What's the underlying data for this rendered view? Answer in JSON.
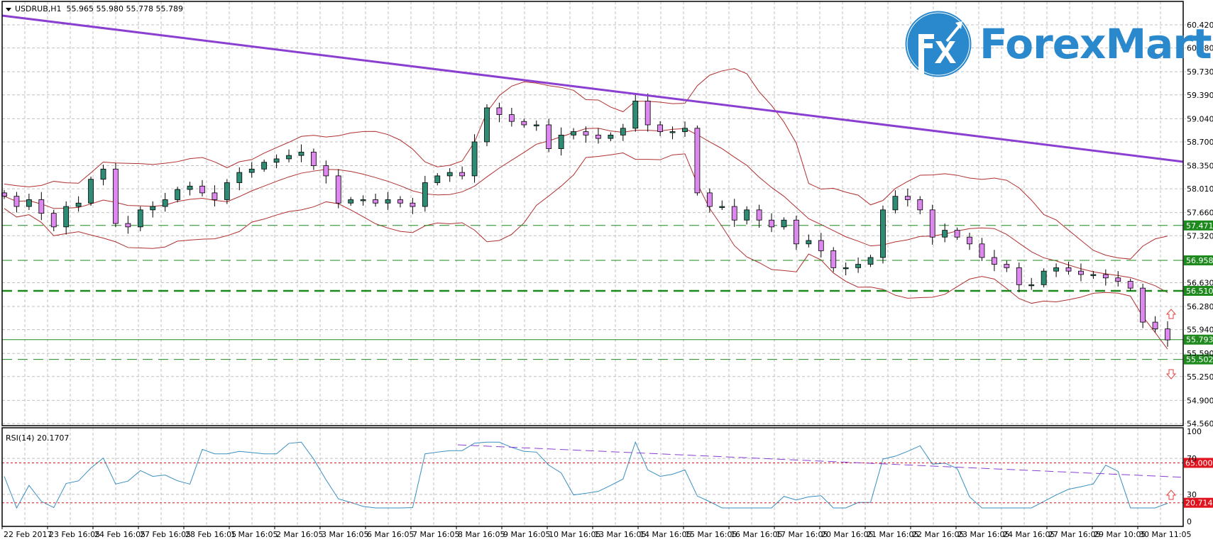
{
  "header": {
    "symbol": "USDRUB,H1",
    "ohlc": "55.965 55.980 55.778 55.789"
  },
  "logo": {
    "text": "ForexMart",
    "mark": "Fx",
    "color": "#2a88cc"
  },
  "chart_data": {
    "type": "candlestick",
    "symbol": "USDRUB",
    "timeframe": "H1",
    "price_ticks": [
      "60.420",
      "60.080",
      "59.730",
      "59.390",
      "59.040",
      "58.700",
      "58.350",
      "58.010",
      "57.660",
      "57.320",
      "56.630",
      "56.280",
      "55.940",
      "55.590",
      "55.250",
      "54.900",
      "54.560"
    ],
    "ylim": [
      54.56,
      60.42
    ],
    "grid": true,
    "closes": [
      57.9,
      57.75,
      57.85,
      57.65,
      57.45,
      57.75,
      57.8,
      58.15,
      58.3,
      57.5,
      57.45,
      57.7,
      57.75,
      57.85,
      58.0,
      58.05,
      57.95,
      57.85,
      58.1,
      58.25,
      58.3,
      58.4,
      58.45,
      58.5,
      58.55,
      58.35,
      58.2,
      57.8,
      57.85,
      57.85,
      57.8,
      57.85,
      57.8,
      57.75,
      58.1,
      58.2,
      58.25,
      58.2,
      58.7,
      59.2,
      59.1,
      59.0,
      58.95,
      58.95,
      58.6,
      58.8,
      58.85,
      58.8,
      58.75,
      58.8,
      58.9,
      59.3,
      58.95,
      58.85,
      58.85,
      58.9,
      57.95,
      57.75,
      57.75,
      57.55,
      57.7,
      57.55,
      57.45,
      57.55,
      57.2,
      57.25,
      57.1,
      56.85,
      56.85,
      56.9,
      57.0,
      57.7,
      57.9,
      57.85,
      57.7,
      57.3,
      57.4,
      57.3,
      57.2,
      57.0,
      56.9,
      56.85,
      56.6,
      56.6,
      56.8,
      56.85,
      56.8,
      56.75,
      56.75,
      56.7,
      56.65,
      56.55,
      56.05,
      55.95,
      55.789
    ],
    "trendline": {
      "from_price": 60.556,
      "to_price": 58.408,
      "color": "#8a3fd1"
    },
    "levels": [
      {
        "price": 57.471,
        "label": "57.471",
        "style": "dashed"
      },
      {
        "price": 56.958,
        "label": "56.958",
        "style": "dashed"
      },
      {
        "price": 56.51,
        "label": "56.510",
        "style": "dashed-bold"
      },
      {
        "price": 55.793,
        "label": "55.793",
        "style": "solid"
      },
      {
        "price": 55.502,
        "label": "55.502",
        "style": "dashed"
      }
    ],
    "level_color": "#1e8a1e",
    "bull_color": "#2e8b74",
    "bear_color": "#dd88ee",
    "band_color": "#b03030",
    "x_ticks": [
      "22 Feb 2017",
      "23 Feb 16:05",
      "24 Feb 16:05",
      "27 Feb 16:05",
      "28 Feb 16:05",
      "1 Mar 16:05",
      "2 Mar 16:05",
      "3 Mar 16:05",
      "6 Mar 16:05",
      "7 Mar 16:05",
      "8 Mar 16:05",
      "9 Mar 16:05",
      "10 Mar 16:05",
      "13 Mar 16:05",
      "14 Mar 16:05",
      "15 Mar 16:05",
      "16 Mar 16:05",
      "17 Mar 16:05",
      "20 Mar 16:05",
      "21 Mar 16:05",
      "22 Mar 16:05",
      "23 Mar 16:05",
      "24 Mar 16:05",
      "27 Mar 16:05",
      "29 Mar 10:05",
      "30 Mar 11:05"
    ],
    "rsi": {
      "title": "RSI(14) 20.1707",
      "ticks": [
        "100",
        "70",
        "30",
        "0"
      ],
      "levels": [
        {
          "value": 65.0,
          "label": "65.0000"
        },
        {
          "value": 20.7143,
          "label": "20.7143"
        }
      ],
      "level_color": "#e0141e",
      "line_color": "#3a8fc0",
      "trendline": {
        "from_value": 85,
        "to_value": 49,
        "color": "#8a3fd1"
      }
    },
    "arrows": [
      {
        "panel": "price",
        "direction": "up"
      },
      {
        "panel": "price",
        "direction": "down"
      },
      {
        "panel": "rsi",
        "direction": "up"
      }
    ]
  }
}
